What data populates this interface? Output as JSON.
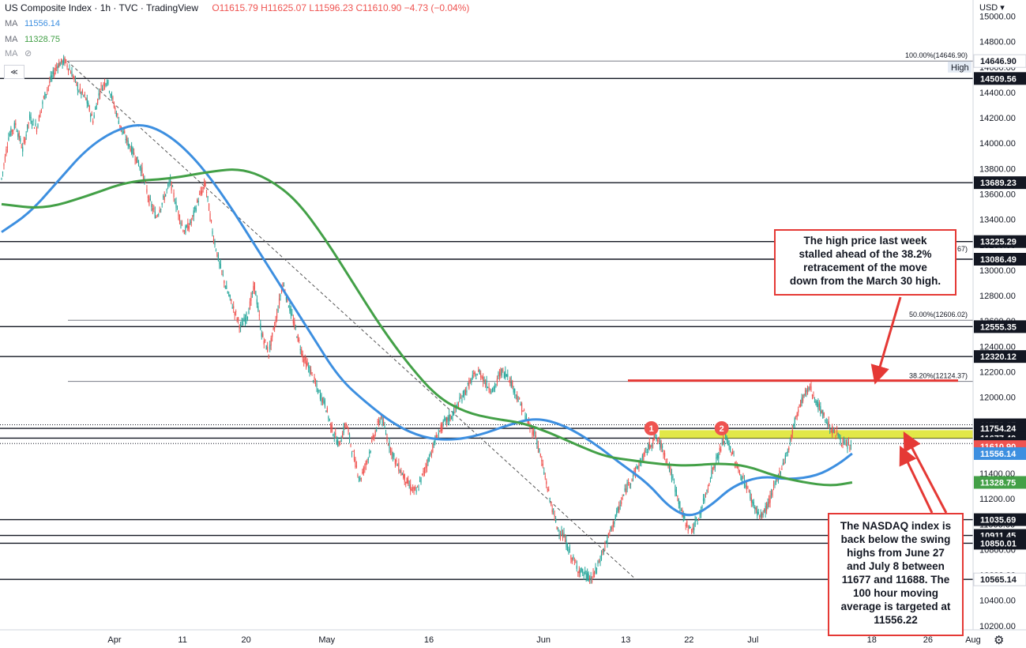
{
  "legend": {
    "title": "US Composite Index · 1h · TVC · TradingView",
    "ohlc": "O11615.79 H11625.07 L11596.23 C11610.90 −4.73 (−0.04%)",
    "ma1_label": "MA",
    "ma1_value": "11556.14",
    "ma2_label": "MA",
    "ma2_value": "11328.75",
    "ma3_label": "MA"
  },
  "currency": "USD",
  "colors": {
    "ma100": "#3d8fe0",
    "ma200": "#43a047",
    "note_border": "#e53935",
    "resistance_line": "#e53935",
    "swing_zone": "#dfe635",
    "candle_up": "#26a69a",
    "candle_down": "#ef5350",
    "price_tag": "#ef5350",
    "ma100_tag": "#3d8fe0",
    "ma200_tag": "#43a047"
  },
  "chart_data": {
    "type": "line",
    "title": "US Composite Index · 1h · TVC · TradingView",
    "xlabel": "",
    "ylabel": "",
    "ylim": [
      10130,
      15100
    ],
    "grid": false,
    "y_ticks": [
      "15000.00",
      "14800.00",
      "14600.00",
      "14400.00",
      "14200.00",
      "14000.00",
      "13800.00",
      "13600.00",
      "13400.00",
      "13200.00",
      "13000.00",
      "12800.00",
      "12600.00",
      "12400.00",
      "12200.00",
      "12000.00",
      "11800.00",
      "11600.00",
      "11400.00",
      "11200.00",
      "11000.00",
      "10800.00",
      "10600.00",
      "10400.00",
      "10200.00"
    ],
    "x_ticks": [
      {
        "label": "Apr",
        "t": 16
      },
      {
        "label": "11",
        "t": 26
      },
      {
        "label": "20",
        "t": 35
      },
      {
        "label": "May",
        "t": 46
      },
      {
        "label": "16",
        "t": 61
      },
      {
        "label": "Jun",
        "t": 77
      },
      {
        "label": "13",
        "t": 89
      },
      {
        "label": "22",
        "t": 98
      },
      {
        "label": "Jul",
        "t": 107
      },
      {
        "label": "18",
        "t": 124
      },
      {
        "label": "26",
        "t": 132
      },
      {
        "label": "Aug",
        "t": 138
      }
    ],
    "xlim": [
      0,
      142
    ],
    "price_path": [
      [
        0,
        13720
      ],
      [
        1,
        14050
      ],
      [
        2,
        14150
      ],
      [
        3,
        13950
      ],
      [
        4,
        14200
      ],
      [
        5,
        14120
      ],
      [
        6,
        14350
      ],
      [
        7,
        14500
      ],
      [
        8,
        14620
      ],
      [
        9,
        14646.9
      ],
      [
        10,
        14550
      ],
      [
        11,
        14420
      ],
      [
        12,
        14350
      ],
      [
        13,
        14180
      ],
      [
        14,
        14420
      ],
      [
        15,
        14500
      ],
      [
        16,
        14300
      ],
      [
        17,
        14120
      ],
      [
        18,
        14000
      ],
      [
        19,
        13900
      ],
      [
        20,
        13780
      ],
      [
        21,
        13550
      ],
      [
        22,
        13420
      ],
      [
        23,
        13550
      ],
      [
        24,
        13700
      ],
      [
        25,
        13480
      ],
      [
        26,
        13300
      ],
      [
        27,
        13380
      ],
      [
        28,
        13560
      ],
      [
        29,
        13680
      ],
      [
        30,
        13300
      ],
      [
        31,
        13050
      ],
      [
        32,
        12850
      ],
      [
        33,
        12700
      ],
      [
        34,
        12550
      ],
      [
        35,
        12650
      ],
      [
        36,
        12880
      ],
      [
        37,
        12500
      ],
      [
        38,
        12350
      ],
      [
        39,
        12600
      ],
      [
        40,
        12900
      ],
      [
        41,
        12700
      ],
      [
        42,
        12500
      ],
      [
        43,
        12300
      ],
      [
        44,
        12200
      ],
      [
        45,
        12050
      ],
      [
        46,
        11950
      ],
      [
        47,
        11750
      ],
      [
        48,
        11620
      ],
      [
        49,
        11800
      ],
      [
        50,
        11550
      ],
      [
        51,
        11350
      ],
      [
        52,
        11500
      ],
      [
        53,
        11700
      ],
      [
        54,
        11850
      ],
      [
        55,
        11650
      ],
      [
        56,
        11500
      ],
      [
        57,
        11400
      ],
      [
        58,
        11300
      ],
      [
        59,
        11250
      ],
      [
        60,
        11400
      ],
      [
        61,
        11550
      ],
      [
        62,
        11700
      ],
      [
        63,
        11800
      ],
      [
        64,
        11850
      ],
      [
        65,
        11950
      ],
      [
        66,
        12050
      ],
      [
        67,
        12150
      ],
      [
        68,
        12200
      ],
      [
        69,
        12100
      ],
      [
        70,
        12050
      ],
      [
        71,
        12200
      ],
      [
        72,
        12180
      ],
      [
        73,
        12050
      ],
      [
        74,
        11920
      ],
      [
        75,
        11780
      ],
      [
        76,
        11700
      ],
      [
        77,
        11450
      ],
      [
        78,
        11200
      ],
      [
        79,
        10980
      ],
      [
        80,
        10900
      ],
      [
        81,
        10750
      ],
      [
        82,
        10650
      ],
      [
        83,
        10600
      ],
      [
        84,
        10565.14
      ],
      [
        85,
        10700
      ],
      [
        86,
        10850
      ],
      [
        87,
        11000
      ],
      [
        88,
        11150
      ],
      [
        89,
        11300
      ],
      [
        90,
        11400
      ],
      [
        91,
        11500
      ],
      [
        92,
        11600
      ],
      [
        93,
        11690
      ],
      [
        94,
        11600
      ],
      [
        95,
        11450
      ],
      [
        96,
        11250
      ],
      [
        97,
        11050
      ],
      [
        98,
        10950
      ],
      [
        99,
        11020
      ],
      [
        100,
        11200
      ],
      [
        101,
        11400
      ],
      [
        102,
        11550
      ],
      [
        103,
        11688
      ],
      [
        104,
        11550
      ],
      [
        105,
        11400
      ],
      [
        106,
        11300
      ],
      [
        107,
        11150
      ],
      [
        108,
        11050
      ],
      [
        109,
        11150
      ],
      [
        110,
        11300
      ],
      [
        111,
        11450
      ],
      [
        112,
        11600
      ],
      [
        113,
        11850
      ],
      [
        114,
        12000
      ],
      [
        115,
        12080
      ],
      [
        116,
        11950
      ],
      [
        117,
        11850
      ],
      [
        118,
        11750
      ],
      [
        119,
        11700
      ],
      [
        120,
        11615.8
      ],
      [
        121,
        11610.9
      ]
    ],
    "series": [
      {
        "name": "MA",
        "last": 11556.14,
        "values": [
          [
            0,
            13300
          ],
          [
            4,
            13450
          ],
          [
            8,
            13700
          ],
          [
            12,
            13950
          ],
          [
            16,
            14100
          ],
          [
            20,
            14160
          ],
          [
            24,
            14060
          ],
          [
            28,
            13850
          ],
          [
            32,
            13550
          ],
          [
            36,
            13200
          ],
          [
            40,
            12850
          ],
          [
            44,
            12500
          ],
          [
            48,
            12150
          ],
          [
            52,
            11950
          ],
          [
            56,
            11780
          ],
          [
            60,
            11680
          ],
          [
            64,
            11660
          ],
          [
            68,
            11700
          ],
          [
            72,
            11780
          ],
          [
            76,
            11840
          ],
          [
            80,
            11780
          ],
          [
            84,
            11650
          ],
          [
            88,
            11480
          ],
          [
            92,
            11320
          ],
          [
            95,
            11130
          ],
          [
            98,
            11050
          ],
          [
            101,
            11150
          ],
          [
            104,
            11300
          ],
          [
            108,
            11380
          ],
          [
            112,
            11350
          ],
          [
            116,
            11380
          ],
          [
            119,
            11470
          ],
          [
            121,
            11556.14
          ]
        ]
      },
      {
        "name": "MA",
        "last": 11328.75,
        "values": [
          [
            0,
            13520
          ],
          [
            6,
            13480
          ],
          [
            12,
            13580
          ],
          [
            18,
            13700
          ],
          [
            24,
            13720
          ],
          [
            30,
            13780
          ],
          [
            34,
            13800
          ],
          [
            38,
            13720
          ],
          [
            42,
            13550
          ],
          [
            46,
            13250
          ],
          [
            50,
            12900
          ],
          [
            54,
            12550
          ],
          [
            58,
            12250
          ],
          [
            62,
            12000
          ],
          [
            66,
            11880
          ],
          [
            70,
            11830
          ],
          [
            74,
            11800
          ],
          [
            78,
            11720
          ],
          [
            82,
            11620
          ],
          [
            86,
            11530
          ],
          [
            90,
            11500
          ],
          [
            94,
            11470
          ],
          [
            98,
            11460
          ],
          [
            102,
            11480
          ],
          [
            106,
            11460
          ],
          [
            110,
            11380
          ],
          [
            114,
            11330
          ],
          [
            118,
            11300
          ],
          [
            121,
            11328.75
          ]
        ]
      }
    ],
    "horizontal_levels": [
      14509.56,
      13689.23,
      13225.29,
      13086.49,
      12555.35,
      12320.12,
      11782.67,
      11754.24,
      11677.49,
      11635.31,
      11035.69,
      10911.45,
      10850.01,
      10565.14
    ],
    "fib_levels": [
      {
        "label": "100.00%(14646.90)",
        "value": 14646.9
      },
      {
        "label": "50.00%(12606.02)",
        "value": 12606.02
      },
      {
        "label": "38.20%(12124.37)",
        "value": 12124.37
      }
    ],
    "fib_partial_label": "67)",
    "swing_zone": [
      11677,
      11740
    ],
    "resistance_level": 12124.37,
    "markers": [
      {
        "label": "1",
        "t": 93,
        "value": 11740
      },
      {
        "label": "2",
        "t": 103,
        "value": 11740
      }
    ],
    "price_labels": [
      {
        "text": "15000.00",
        "kind": "tick"
      },
      {
        "text": "14646.90",
        "kind": "plain",
        "value": 14646.9
      },
      {
        "text": "High",
        "kind": "small"
      },
      {
        "text": "14509.56",
        "kind": "black",
        "value": 14509.56
      },
      {
        "text": "13689.23",
        "kind": "black",
        "value": 13689.23
      },
      {
        "text": "13225.29",
        "kind": "black",
        "value": 13225.29
      },
      {
        "text": "13086.49",
        "kind": "black",
        "value": 13086.49
      },
      {
        "text": "12555.35",
        "kind": "black",
        "value": 12555.35
      },
      {
        "text": "12320.12",
        "kind": "black",
        "value": 12320.12
      },
      {
        "text": "11782.67",
        "kind": "black",
        "value": 11782.67
      },
      {
        "text": "11754.24",
        "kind": "black",
        "value": 11754.24
      },
      {
        "text": "11677.49",
        "kind": "black",
        "value": 11677.49
      },
      {
        "text": "11635.31",
        "kind": "black",
        "value": 11635.31
      },
      {
        "text": "11610.90",
        "kind": "red",
        "value": 11610.9
      },
      {
        "text": "11556.14",
        "kind": "blue",
        "value": 11556.14
      },
      {
        "text": "11328.75",
        "kind": "green",
        "value": 11328.75
      },
      {
        "text": "11035.69",
        "kind": "black",
        "value": 11035.69
      },
      {
        "text": "10911.45",
        "kind": "black",
        "value": 10911.45
      },
      {
        "text": "10850.01",
        "kind": "black",
        "value": 10850.01
      },
      {
        "text": "10565.14",
        "kind": "plain",
        "value": 10565.14
      }
    ]
  },
  "annotations": {
    "note1": [
      "The high price last week",
      "stalled ahead of the 38.2%",
      "retracement of the move",
      "down from the March 30 high."
    ],
    "note2": [
      "The NASDAQ index is",
      "back below the swing",
      "highs from June 27",
      "and July 8 between",
      "11677 and 11688. The",
      "100 hour moving",
      "average is targeted at",
      "11556.22"
    ]
  },
  "ui": {
    "nav_label": "≪",
    "settings_icon": "⚙"
  }
}
